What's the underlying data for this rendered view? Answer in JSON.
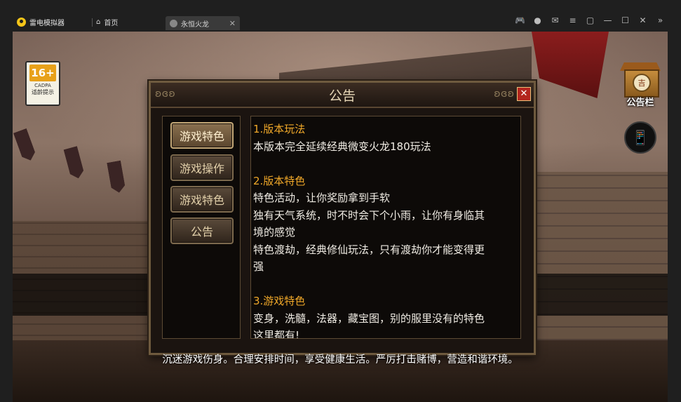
{
  "titlebar": {
    "app_name": "雷电模拟器",
    "home_tab": "首页",
    "game_tab": "永恒火龙",
    "tab_close": "✕",
    "controls": [
      "🎮",
      "●",
      "✉",
      "≡",
      "▢",
      "—",
      "☐",
      "✕",
      "»"
    ]
  },
  "game": {
    "age_rating": {
      "age": "16+",
      "org": "CADPA",
      "hint": "适龄提示"
    },
    "notice_icon": {
      "glyph": "吉",
      "label": "公告栏"
    },
    "phone_icon": "📱",
    "dialog": {
      "title": "公告",
      "close": "✕",
      "ornament_left": "ʚ ɞ ʚ",
      "ornament_right": "ʚ ɞ ʚ",
      "side_buttons": [
        {
          "label": "游戏特色",
          "active": true
        },
        {
          "label": "游戏操作",
          "active": false
        },
        {
          "label": "游戏特色",
          "active": false
        },
        {
          "label": "公告",
          "active": false
        }
      ],
      "content": {
        "s1_title": "1.版本玩法",
        "s1_line1": "本版本完全延续经典微变火龙180玩法",
        "s2_title": "2.版本特色",
        "s2_line1": "特色活动，让你奖励拿到手软",
        "s2_line2": "独有天气系统，时不时会下个小雨，让你有身临其",
        "s2_line3": "境的感觉",
        "s2_line4": "特色渡劫，经典修仙玩法，只有渡劫你才能变得更",
        "s2_line5": "强",
        "s3_title": "3.游戏特色",
        "s3_line1": "变身，洗髓，法器，藏宝图，别的服里没有的特色",
        "s3_line2": "这里都有!"
      }
    },
    "health_notice": "沉迷游戏伤身。合理安排时间，享受健康生活。严厉打击赌博，营造和谐环境。"
  },
  "colors": {
    "accent": "#f0a829",
    "dialog_bg": "#1b1410",
    "close_red": "#b3261e"
  }
}
